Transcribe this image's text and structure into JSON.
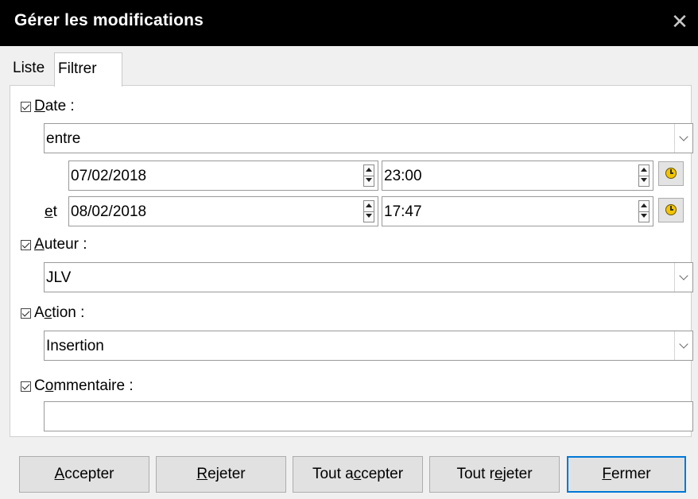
{
  "window": {
    "title": "Gérer les modifications",
    "close_glyph": "✕"
  },
  "tabs": [
    {
      "label": "Liste",
      "active": false
    },
    {
      "label": "Filtrer",
      "active": true
    }
  ],
  "filter": {
    "date": {
      "checked": true,
      "label_accel": "D",
      "label_rest": "ate :",
      "mode": "entre",
      "start_date": "07/02/2018",
      "start_time": "23:00",
      "and_label_accel": "e",
      "and_label_rest": "t",
      "end_date": "08/02/2018",
      "end_time": "17:47"
    },
    "author": {
      "checked": true,
      "label_accel": "A",
      "label_rest": "uteur :",
      "value": "JLV"
    },
    "action": {
      "checked": true,
      "label_pre": "A",
      "label_accel": "c",
      "label_rest": "tion :",
      "value": "Insertion"
    },
    "comment": {
      "checked": true,
      "label_pre": "C",
      "label_accel": "o",
      "label_rest": "mmentaire :",
      "value": ""
    }
  },
  "buttons": {
    "accept": {
      "accel": "A",
      "rest": "ccepter"
    },
    "reject": {
      "accel": "R",
      "rest": "ejeter"
    },
    "accept_all": {
      "pre": "Tout a",
      "accel": "c",
      "rest": "cepter"
    },
    "reject_all": {
      "pre": "Tout r",
      "accel": "e",
      "rest": "jeter"
    },
    "close": {
      "accel": "F",
      "rest": "ermer"
    }
  },
  "icons": {
    "clock": "clock-icon",
    "spin_up": "spin-up-icon",
    "spin_down": "spin-down-icon",
    "dropdown": "chevron-down-icon"
  },
  "colors": {
    "titlebar_bg": "#000000",
    "default_button_border": "#0078d7",
    "clock_face": "#f3c500"
  }
}
